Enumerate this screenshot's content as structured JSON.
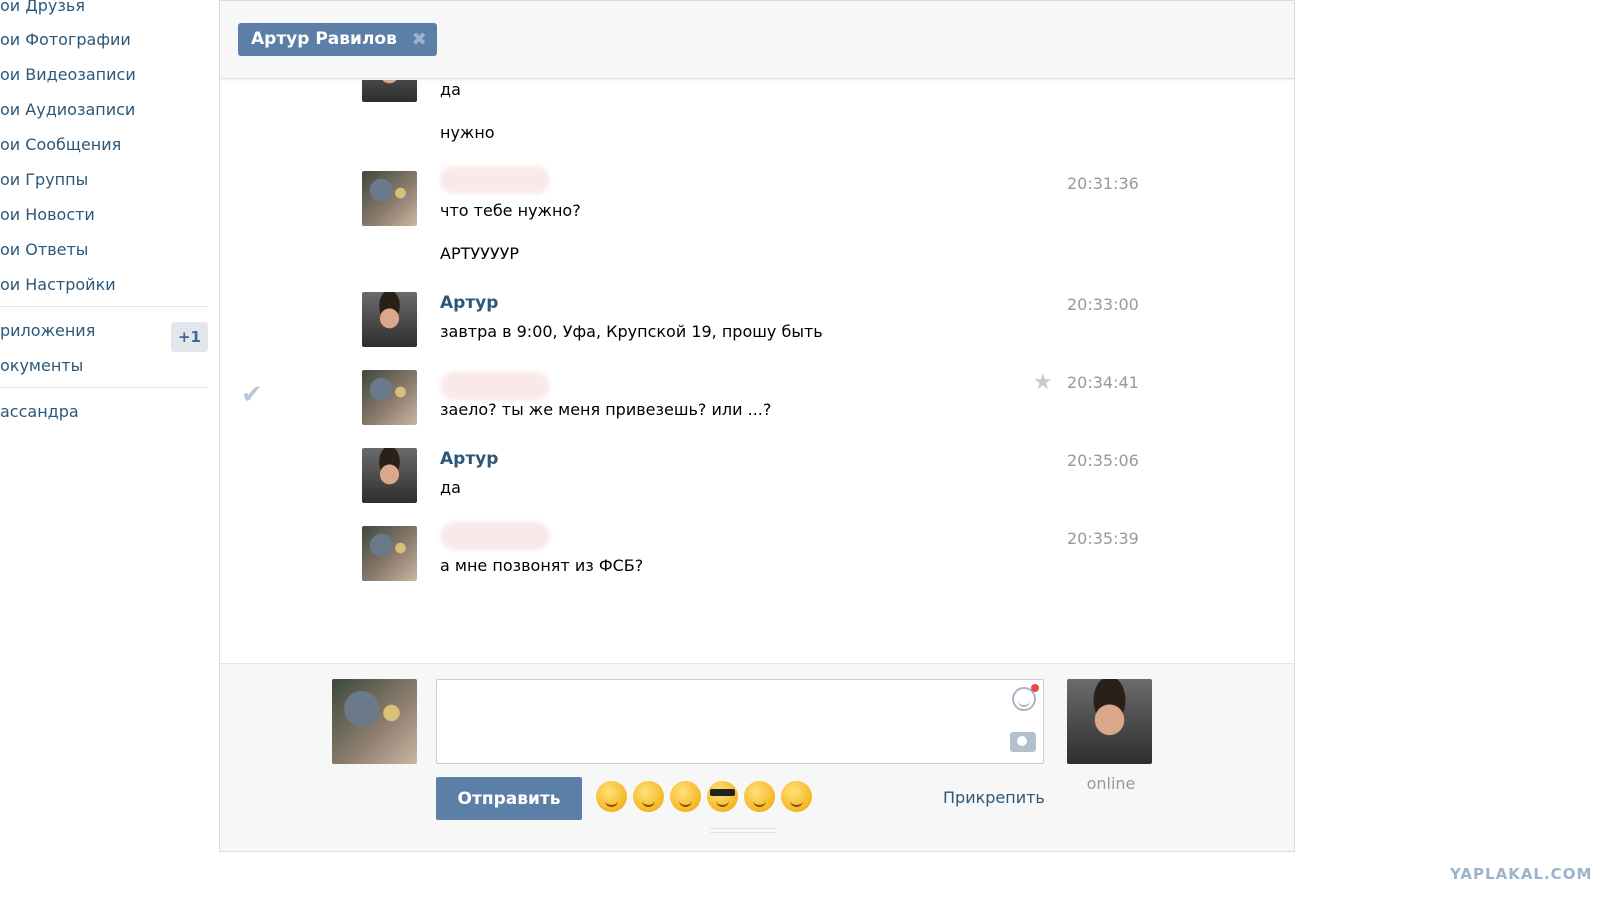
{
  "sidebar": {
    "items": [
      {
        "label": "ои Друзья"
      },
      {
        "label": "ои Фотографии"
      },
      {
        "label": "ои Видеозаписи"
      },
      {
        "label": "ои Аудиозаписи"
      },
      {
        "label": "ои Сообщения"
      },
      {
        "label": "ои Группы"
      },
      {
        "label": "ои Новости"
      },
      {
        "label": "ои Ответы"
      },
      {
        "label": "ои Настройки"
      },
      {
        "label": "риложения"
      },
      {
        "label": "окументы"
      },
      {
        "label": "ассандра"
      }
    ],
    "apps_badge": "+1"
  },
  "dialog": {
    "tab_title": "Артур Равилов",
    "tab_close": "✖"
  },
  "messages": [
    {
      "text": "да"
    },
    {
      "text": "нужно"
    },
    {
      "sender": "",
      "time": "20:31:36",
      "text": "что тебе нужно?"
    },
    {
      "text": "АРТУУУУР"
    },
    {
      "sender": "Артур",
      "time": "20:33:00",
      "text": "завтра в 9:00, Уфа, Крупской 19, прошу быть"
    },
    {
      "sender": "",
      "time": "20:34:41",
      "text": "заело? ты же меня привезешь? или ...?"
    },
    {
      "sender": "Артур",
      "time": "20:35:06",
      "text": "да"
    },
    {
      "sender": "",
      "time": "20:35:39",
      "text": "а мне позвонят из ФСБ?"
    }
  ],
  "composer": {
    "send_label": "Отправить",
    "attach_label": "Прикрепить",
    "status": "online",
    "emojis": [
      "grinning-face-icon",
      "anxious-face-icon",
      "crying-face-icon",
      "sunglasses-face-icon",
      "yum-face-icon",
      "smiling-face-icon"
    ]
  },
  "watermark": "YAPLAKAL.COM",
  "colors": {
    "accent": "#5b7fa7",
    "link": "#2b587a",
    "muted": "#999999"
  }
}
